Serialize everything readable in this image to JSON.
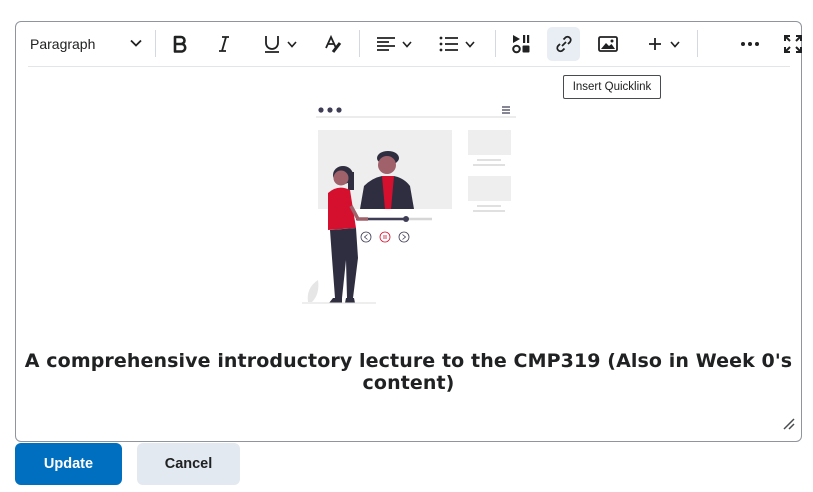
{
  "toolbar": {
    "paragraph_label": "Paragraph",
    "tooltip": "Insert Quicklink",
    "buttons": [
      {
        "name": "bold",
        "icon": "bold-icon"
      },
      {
        "name": "italic",
        "icon": "italic-icon"
      },
      {
        "name": "underline",
        "icon": "underline-icon"
      },
      {
        "name": "format",
        "icon": "format-painter-icon"
      },
      {
        "name": "align",
        "icon": "align-left-icon"
      },
      {
        "name": "list",
        "icon": "bullet-list-icon"
      },
      {
        "name": "media",
        "icon": "insert-media-icon"
      },
      {
        "name": "quicklink",
        "icon": "link-icon",
        "active": true
      },
      {
        "name": "image",
        "icon": "image-icon"
      },
      {
        "name": "insert",
        "icon": "plus-icon"
      },
      {
        "name": "more",
        "icon": "more-icon"
      },
      {
        "name": "fullscreen",
        "icon": "fullscreen-icon"
      }
    ]
  },
  "content": {
    "caption": "A comprehensive introductory lecture to the CMP319 (Also in Week 0's content)"
  },
  "actions": {
    "update_label": "Update",
    "cancel_label": "Cancel"
  },
  "colors": {
    "primary": "#006fbf",
    "accent_red": "#d5102f",
    "border": "#8f959c"
  }
}
